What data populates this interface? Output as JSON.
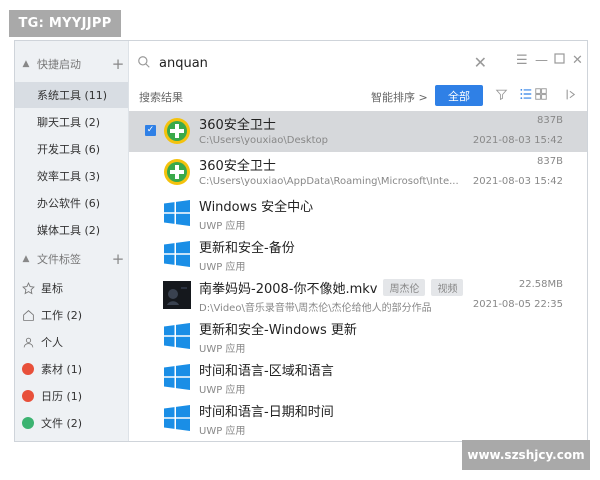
{
  "watermarks": {
    "top": "TG: MYYJJPP",
    "bottom": "www.szshjcy.com"
  },
  "sidebar": {
    "quick_launch": {
      "label": "快捷启动",
      "add_icon": "plus-icon"
    },
    "items": [
      {
        "label": "系统工具 (11)",
        "active": true
      },
      {
        "label": "聊天工具 (2)",
        "active": false
      },
      {
        "label": "开发工具 (6)",
        "active": false
      },
      {
        "label": "效率工具 (3)",
        "active": false
      },
      {
        "label": "办公软件 (6)",
        "active": false
      },
      {
        "label": "媒体工具 (2)",
        "active": false
      }
    ],
    "file_tags": {
      "label": "文件标签",
      "add_icon": "plus-icon"
    },
    "tags": [
      {
        "label": "星标",
        "icon": "star-icon"
      },
      {
        "label": "工作 (2)",
        "icon": "home-icon"
      },
      {
        "label": "个人",
        "icon": "user-icon"
      },
      {
        "label": "素材 (1)",
        "icon": "dot",
        "color": "#e8503a"
      },
      {
        "label": "日历 (1)",
        "icon": "dot",
        "color": "#e8503a"
      },
      {
        "label": "文件 (2)",
        "icon": "dot",
        "color": "#3cb371"
      }
    ]
  },
  "search": {
    "value": "anquan",
    "clear_icon": "close-icon"
  },
  "window_controls": [
    "menu-icon",
    "minimize-icon",
    "maximize-icon",
    "close-icon"
  ],
  "toolbar": {
    "results_label": "搜索结果",
    "sort_label": "智能排序 >",
    "all_button": "全部",
    "icons": [
      "filter-icon",
      "list-view-icon",
      "grid-view-icon",
      "panel-toggle-icon"
    ]
  },
  "results": [
    {
      "name": "360安全卫士",
      "path": "C:\\Users\\youxiao\\Desktop",
      "size": "837B",
      "date": "2021-08-03 15:42",
      "icon": "360-safe-icon",
      "selected": true
    },
    {
      "name": "360安全卫士",
      "path": "C:\\Users\\youxiao\\AppData\\Roaming\\Microsoft\\Inte...",
      "size": "837B",
      "date": "2021-08-03 15:42",
      "icon": "360-safe-icon",
      "selected": false
    },
    {
      "name": "Windows 安全中心",
      "path": "UWP 应用",
      "size": "",
      "date": "",
      "icon": "windows-icon",
      "selected": false
    },
    {
      "name": "更新和安全-备份",
      "path": "UWP 应用",
      "size": "",
      "date": "",
      "icon": "windows-icon",
      "selected": false
    },
    {
      "name": "南拳妈妈-2008-你不像她.mkv",
      "path": "D:\\Video\\音乐录音带\\周杰伦\\杰伦给他人的部分作品",
      "size": "22.58MB",
      "date": "2021-08-05 22:35",
      "icon": "video-thumbnail",
      "selected": false,
      "tags": [
        "周杰伦",
        "视频"
      ]
    },
    {
      "name": "更新和安全-Windows 更新",
      "path": "UWP 应用",
      "size": "",
      "date": "",
      "icon": "windows-icon",
      "selected": false
    },
    {
      "name": "时间和语言-区域和语言",
      "path": "UWP 应用",
      "size": "",
      "date": "",
      "icon": "windows-icon",
      "selected": false
    },
    {
      "name": "时间和语言-日期和时间",
      "path": "UWP 应用",
      "size": "",
      "date": "",
      "icon": "windows-icon",
      "selected": false
    }
  ],
  "colors": {
    "accent": "#2f80e6",
    "selected_row": "#d6d8db",
    "sidebar_bg": "#eef1f4"
  }
}
